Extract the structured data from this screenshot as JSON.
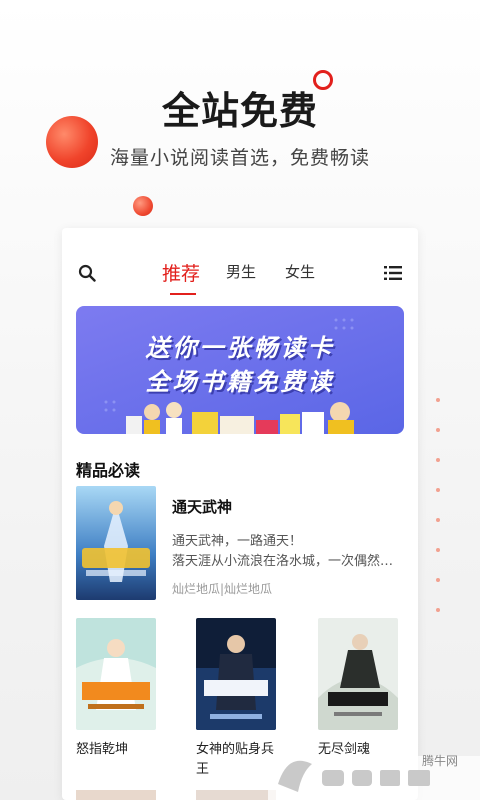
{
  "promo": {
    "title": "全站免费",
    "subtitle": "海量小说阅读首选，免费畅读"
  },
  "tabs": [
    {
      "label": "推荐",
      "active": true
    },
    {
      "label": "男生",
      "active": false
    },
    {
      "label": "女生",
      "active": false
    }
  ],
  "banner": {
    "line1": "送你一张畅读卡",
    "line2": "全场书籍免费读"
  },
  "section": {
    "title": "精品必读"
  },
  "featured": {
    "title": "通天武神",
    "desc_line1": "通天武神，一路通天！",
    "desc_line2": "落天涯从小流浪在洛水城，一次偶然的…",
    "author": "灿烂地瓜|灿烂地瓜"
  },
  "grid": [
    {
      "name": "怒指乾坤"
    },
    {
      "name": "女神的贴身兵王"
    },
    {
      "name": "无尽剑魂"
    }
  ],
  "watermark": {
    "brand": "腾牛网"
  },
  "colors": {
    "accent": "#e2201c",
    "banner": "#6b70ec"
  }
}
